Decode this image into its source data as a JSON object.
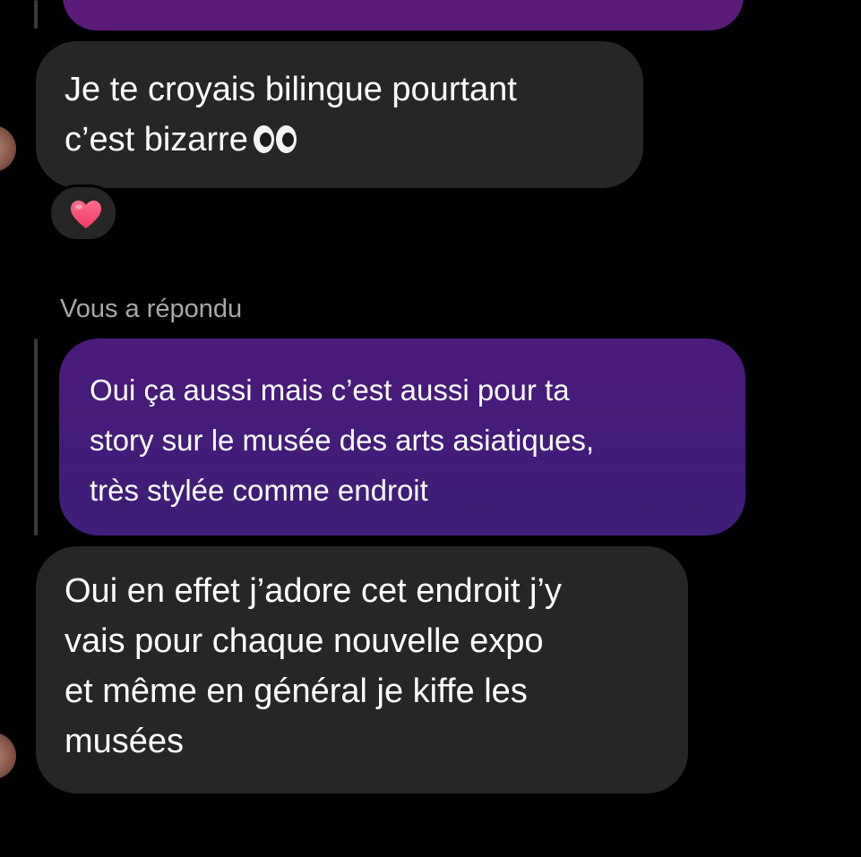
{
  "messages": [
    {
      "direction": "incoming",
      "lines": [
        "Je te croyais bilingue pourtant",
        "c’est bizarre"
      ],
      "emoji": "eyes-emoji",
      "reaction": "heart-emoji"
    },
    {
      "direction": "outgoing",
      "reply_label": "Vous a répondu",
      "lines": [
        "Oui ça aussi mais c’est aussi pour ta",
        "story sur le musée des arts asiatiques,",
        "très stylée comme endroit"
      ]
    },
    {
      "direction": "incoming",
      "lines": [
        "Oui en effet j’adore cet endroit j’y",
        "vais pour chaque nouvelle expo",
        "et même en général je kiffe les",
        "musées"
      ]
    }
  ],
  "colors": {
    "background": "#000000",
    "incoming_bubble": "#262626",
    "outgoing_bubble": "#4b1a7a",
    "meta_text": "#a8a8a8"
  }
}
